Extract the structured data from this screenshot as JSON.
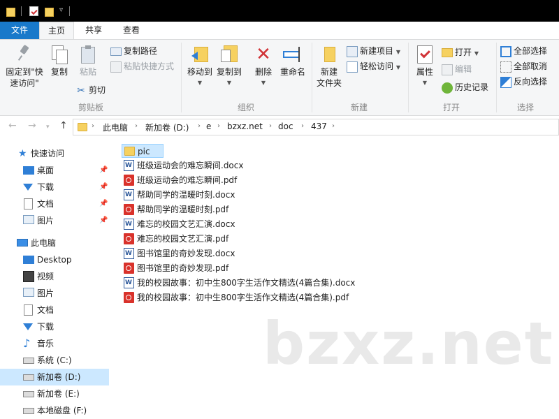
{
  "ribbon_tabs": {
    "file": "文件",
    "home": "主页",
    "share": "共享",
    "view": "查看"
  },
  "clipboard": {
    "pin_line1": "固定到\"快",
    "pin_line2": "速访问\"",
    "copy": "复制",
    "paste": "粘贴",
    "copy_path": "复制路径",
    "paste_shortcut": "粘贴快捷方式",
    "cut": "剪切",
    "label": "剪贴板"
  },
  "organize": {
    "move_to": "移动到",
    "copy_to": "复制到",
    "delete": "删除",
    "rename": "重命名",
    "label": "组织"
  },
  "new_group": {
    "new_folder_line1": "新建",
    "new_folder_line2": "文件夹",
    "new_item": "新建项目",
    "easy_access": "轻松访问",
    "label": "新建"
  },
  "open_group": {
    "properties": "属性",
    "open": "打开",
    "edit": "编辑",
    "history": "历史记录",
    "label": "打开"
  },
  "select_group": {
    "select_all": "全部选择",
    "select_none": "全部取消",
    "invert": "反向选择",
    "label": "选择"
  },
  "breadcrumb": [
    "此电脑",
    "新加卷 (D:)",
    "e",
    "bzxz.net",
    "doc",
    "437"
  ],
  "nav": {
    "quick_access": "快速访问",
    "qa_items": [
      "桌面",
      "下载",
      "文档",
      "图片"
    ],
    "this_pc": "此电脑",
    "pc_items": [
      "Desktop",
      "视频",
      "图片",
      "文档",
      "下载",
      "音乐",
      "系统 (C:)",
      "新加卷 (D:)",
      "新加卷 (E:)",
      "本地磁盘 (F:)"
    ]
  },
  "files": [
    {
      "name": "pic",
      "type": "folder"
    },
    {
      "name": "班级运动会的难忘瞬间.docx",
      "type": "docx"
    },
    {
      "name": "班级运动会的难忘瞬间.pdf",
      "type": "pdf"
    },
    {
      "name": "帮助同学的温暖时刻.docx",
      "type": "docx"
    },
    {
      "name": "帮助同学的温暖时刻.pdf",
      "type": "pdf"
    },
    {
      "name": "难忘的校园文艺汇演.docx",
      "type": "docx"
    },
    {
      "name": "难忘的校园文艺汇演.pdf",
      "type": "pdf"
    },
    {
      "name": "图书馆里的奇妙发现.docx",
      "type": "docx"
    },
    {
      "name": "图书馆里的奇妙发现.pdf",
      "type": "pdf"
    },
    {
      "name": "我的校园故事：初中生800字生活作文精选(4篇合集).docx",
      "type": "docx"
    },
    {
      "name": "我的校园故事：初中生800字生活作文精选(4篇合集).pdf",
      "type": "pdf"
    }
  ],
  "watermark": "bzxz.net"
}
